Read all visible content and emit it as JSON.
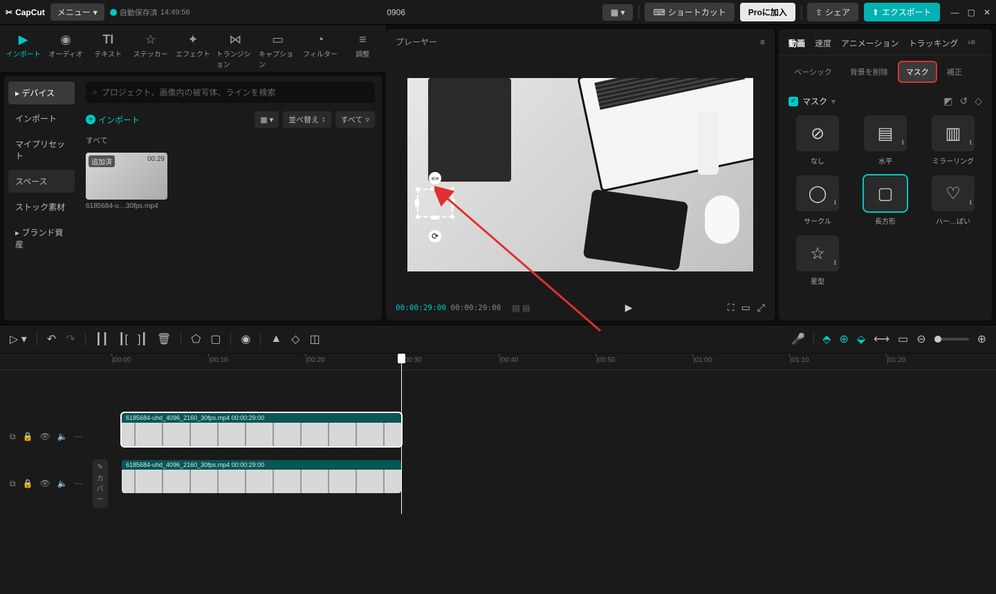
{
  "titlebar": {
    "app": "CapCut",
    "menu": "メニュー",
    "autosave": "自動保存済",
    "autosave_time": "14:49:56",
    "project": "0906",
    "shortcut": "ショートカット",
    "pro": "Proに加入",
    "share": "シェア",
    "export": "エクスポート"
  },
  "top_tabs": [
    {
      "label": "インポート",
      "active": true
    },
    {
      "label": "オーディオ"
    },
    {
      "label": "テキスト"
    },
    {
      "label": "ステッカー"
    },
    {
      "label": "エフェクト"
    },
    {
      "label": "トランジション"
    },
    {
      "label": "キャプション"
    },
    {
      "label": "フィルター"
    },
    {
      "label": "調整"
    }
  ],
  "side_nav": [
    {
      "label": "デバイス",
      "active": true
    },
    {
      "label": "インポート"
    },
    {
      "label": "マイプリセット"
    },
    {
      "label": "スペース"
    },
    {
      "label": "ストック素材"
    },
    {
      "label": "ブランド資産"
    }
  ],
  "media": {
    "search_placeholder": "プロジェクト、画像内の被写体、ラインを検索",
    "import": "インポート",
    "sort": "並べ替え",
    "all": "すべて",
    "section": "すべて",
    "thumb_badge": "追加済",
    "thumb_duration": "00:29",
    "thumb_name": "6185684-u…30fps.mp4"
  },
  "player": {
    "title": "プレーヤー",
    "current": "00:00:29:00",
    "total": "00:00:29:00"
  },
  "right_tabs": [
    {
      "label": "動画",
      "active": true
    },
    {
      "label": "速度"
    },
    {
      "label": "アニメーション"
    },
    {
      "label": "トラッキング"
    }
  ],
  "right_subtabs": [
    {
      "label": "ベーシック"
    },
    {
      "label": "背景を削除"
    },
    {
      "label": "マスク",
      "highlighted": true
    },
    {
      "label": "補正"
    }
  ],
  "mask": {
    "title": "マスク",
    "items": [
      {
        "label": "なし"
      },
      {
        "label": "水平"
      },
      {
        "label": "ミラーリング"
      },
      {
        "label": "サークル"
      },
      {
        "label": "長方形",
        "selected": true
      },
      {
        "label": "ハー…ぱい"
      },
      {
        "label": "星型"
      }
    ]
  },
  "timeline": {
    "ruler": [
      "|00:00",
      "|00:10",
      "|00:20",
      "|00:30",
      "|00:40",
      "|00:50",
      "|01:00",
      "|01:10",
      "|01:20"
    ],
    "cover": "カバー",
    "clip1_label": "6185684-uhd_4096_2160_30fps.mp4  00:00:29:00",
    "clip2_label": "6185684-uhd_4096_2160_30fps.mp4  00:00:29:00"
  }
}
